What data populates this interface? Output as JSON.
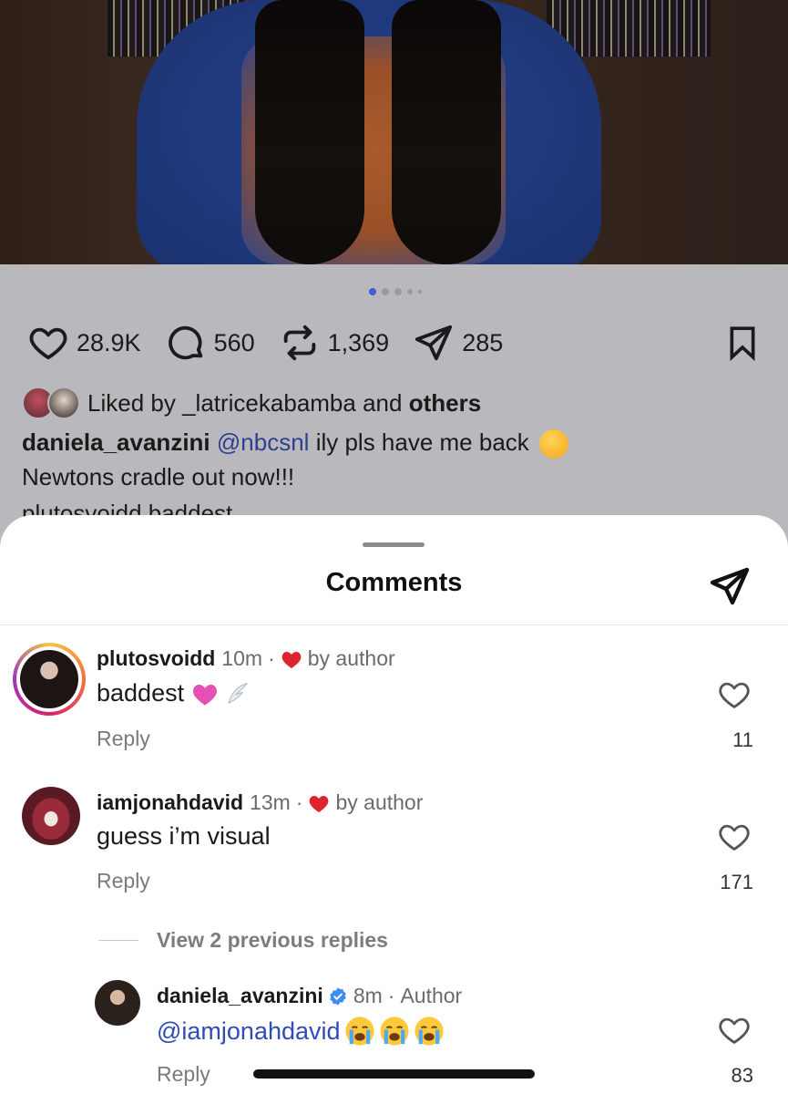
{
  "post": {
    "actions": {
      "likes": "28.9K",
      "comments": "560",
      "reposts": "1,369",
      "shares": "285"
    },
    "liked_by": {
      "prefix": "Liked by",
      "user": "_latricekabamba",
      "joiner": "and",
      "suffix": "others"
    },
    "caption": {
      "user": "daniela_avanzini",
      "mention": "@nbcsnl",
      "text": "ily pls have me back",
      "line2": "Newtons cradle out now!!!"
    },
    "peek_comment": "plutosvoidd baddest"
  },
  "comments_sheet": {
    "title": "Comments",
    "comments": [
      {
        "username": "plutosvoidd",
        "time": "10m",
        "liked_label": "by author",
        "text": "baddest",
        "reply_label": "Reply",
        "likes": "11"
      },
      {
        "username": "iamjonahdavid",
        "time": "13m",
        "liked_label": "by author",
        "text": "guess i’m visual",
        "reply_label": "Reply",
        "likes": "171"
      }
    ],
    "view_replies": "View 2 previous replies",
    "reply": {
      "username": "daniela_avanzini",
      "time": "8m",
      "tag": "Author",
      "text": "@iamjonahdavid",
      "reply_label": "Reply",
      "likes": "83"
    }
  },
  "colors": {
    "accent_blue": "#2f4bb8",
    "heart_red": "#e0242c",
    "carousel_active": "#3e5fd4"
  },
  "icons": [
    "heart-icon",
    "comment-icon",
    "repost-icon",
    "share-icon",
    "bookmark-icon",
    "send-icon",
    "red-heart-icon",
    "verified-icon",
    "pink-heart-emoji",
    "wing-emoji",
    "crying-emoji"
  ]
}
